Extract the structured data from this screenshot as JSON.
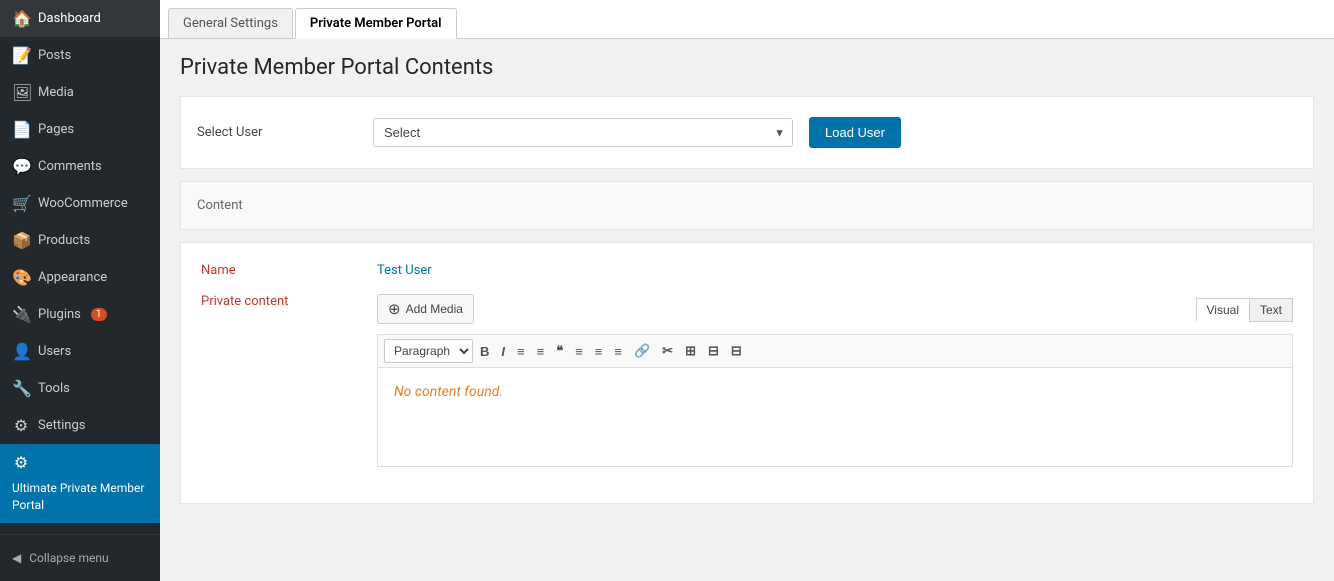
{
  "sidebar": {
    "items": [
      {
        "id": "dashboard",
        "label": "Dashboard",
        "icon": "🏠"
      },
      {
        "id": "posts",
        "label": "Posts",
        "icon": "📝"
      },
      {
        "id": "media",
        "label": "Media",
        "icon": "🖼"
      },
      {
        "id": "pages",
        "label": "Pages",
        "icon": "📄"
      },
      {
        "id": "comments",
        "label": "Comments",
        "icon": "💬"
      },
      {
        "id": "woocommerce",
        "label": "WooCommerce",
        "icon": "🛒"
      },
      {
        "id": "products",
        "label": "Products",
        "icon": "📦"
      },
      {
        "id": "appearance",
        "label": "Appearance",
        "icon": "🎨"
      },
      {
        "id": "plugins",
        "label": "Plugins",
        "icon": "🔌",
        "badge": "1"
      },
      {
        "id": "users",
        "label": "Users",
        "icon": "👤"
      },
      {
        "id": "tools",
        "label": "Tools",
        "icon": "🔧"
      },
      {
        "id": "settings",
        "label": "Settings",
        "icon": "⚙"
      }
    ],
    "active_item": {
      "label": "Ultimate Private Member Portal",
      "icon": "⚙"
    },
    "collapse_label": "Collapse menu"
  },
  "tabs": [
    {
      "id": "general-settings",
      "label": "General Settings"
    },
    {
      "id": "private-member-portal",
      "label": "Private Member Portal"
    }
  ],
  "active_tab": "private-member-portal",
  "page": {
    "title": "Private Member Portal Contents"
  },
  "select_user": {
    "label": "Select User",
    "placeholder": "Select",
    "options": [
      "Select"
    ]
  },
  "load_user_button": "Load User",
  "content_section": {
    "label": "Content"
  },
  "user_details": {
    "name_label": "Name",
    "name_value": "Test User",
    "private_content_label": "Private content"
  },
  "editor": {
    "add_media_label": "Add Media",
    "tabs": [
      "Visual",
      "Text"
    ],
    "active_tab": "Visual",
    "toolbar_paragraph": "Paragraph",
    "no_content_text": "No content found.",
    "toolbar_items": [
      "B",
      "I",
      "≡",
      "≡",
      "❝",
      "≡",
      "≡",
      "≡",
      "🔗",
      "✂",
      "≡",
      "⊞",
      "⊟"
    ]
  }
}
